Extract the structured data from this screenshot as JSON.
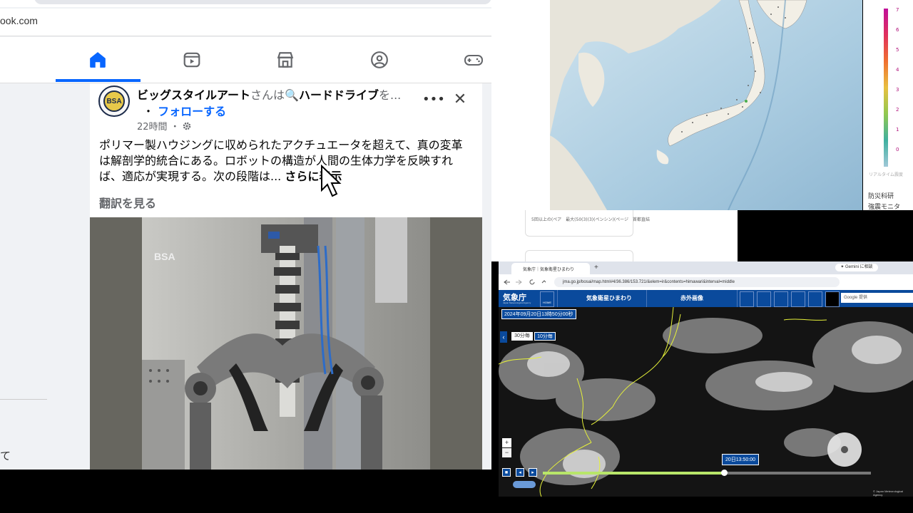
{
  "facebook": {
    "url_fragment": "ook.com",
    "nav": [
      "home-icon",
      "video-icon",
      "marketplace-icon",
      "groups-icon",
      "gaming-icon"
    ],
    "left_fragment": "て",
    "post": {
      "page_name": "ビッグスタイルアート",
      "connector": "さんは",
      "search_icon": "🔍",
      "search_term": "ハードドライブ",
      "suffix": "を...",
      "follow_prefix": "・",
      "follow": "フォローする",
      "time": "22時間",
      "dot": "・",
      "body": "ポリマー製ハウジングに収められたアクチュエータを超えて、真の変革は解剖学的統合にある。ロボットの構造が人間の生体力学を反映すれば、適応が実現する。次の段階は...",
      "see_more": "さらに表示",
      "translate": "翻訳を見る",
      "more_glyph": "•••",
      "close_glyph": "✕",
      "avatar_text": "BSA",
      "image_watermark": "BSA"
    }
  },
  "quake_map": {
    "legend_ticks": [
      "7",
      "6",
      "5",
      "4",
      "3",
      "2",
      "1",
      "0"
    ],
    "legend_caption": "リアルタイム震度",
    "org_line1": "防災科研",
    "org_line2": "強震モニタ"
  },
  "strip": {
    "card_text": "5回以上の(ペア　最大(50(3)(3)(ペンシン)(ページ　首都直結"
  },
  "jma": {
    "tab_title": "気象庁｜気象衛星ひまわり",
    "new_tab": "+",
    "gemini": "✦ Gemini に相談",
    "address": "jma.go.jp/bosai/map.html#4/36.386/153.721/&elem=ir&contents=himawari&interval=middle",
    "logo": "気象庁",
    "logo_sub": "Japan Meteorological Agency",
    "home": "HOME",
    "menu1": "気象衛星ひまわり",
    "menu2": "赤外画像",
    "google_placeholder": "Google 提供",
    "datetime": "2024年09月20日13時50分00秒",
    "interval_30": "30分毎",
    "interval_10": "10分毎",
    "current_time": "20日13:50:00",
    "zoom_in": "+",
    "zoom_out": "−",
    "copyright": "© Japan Meteorological Agency"
  },
  "colors": {
    "fb_blue": "#0866ff",
    "jma_blue": "#0a4a9c",
    "timeline_fill": "#b8e66a"
  }
}
